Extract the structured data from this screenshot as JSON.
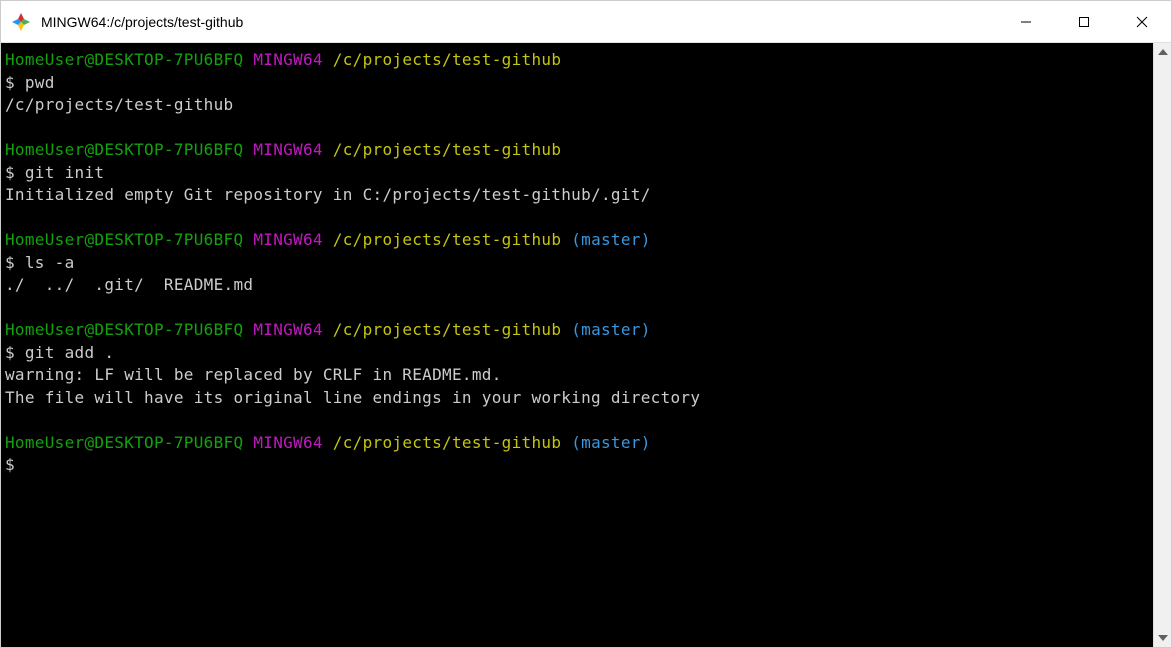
{
  "window": {
    "title": "MINGW64:/c/projects/test-github"
  },
  "terminal": {
    "blocks": [
      {
        "userHost": "HomeUser@DESKTOP-7PU6BFQ",
        "env": "MINGW64",
        "path": "/c/projects/test-github",
        "branch": "",
        "dollar": "$",
        "command": "pwd",
        "output": [
          "/c/projects/test-github"
        ]
      },
      {
        "userHost": "HomeUser@DESKTOP-7PU6BFQ",
        "env": "MINGW64",
        "path": "/c/projects/test-github",
        "branch": "",
        "dollar": "$",
        "command": "git init",
        "output": [
          "Initialized empty Git repository in C:/projects/test-github/.git/"
        ]
      },
      {
        "userHost": "HomeUser@DESKTOP-7PU6BFQ",
        "env": "MINGW64",
        "path": "/c/projects/test-github",
        "branch": "(master)",
        "dollar": "$",
        "command": "ls -a",
        "output": [
          "./  ../  .git/  README.md"
        ]
      },
      {
        "userHost": "HomeUser@DESKTOP-7PU6BFQ",
        "env": "MINGW64",
        "path": "/c/projects/test-github",
        "branch": "(master)",
        "dollar": "$",
        "command": "git add .",
        "output": [
          "warning: LF will be replaced by CRLF in README.md.",
          "The file will have its original line endings in your working directory"
        ]
      },
      {
        "userHost": "HomeUser@DESKTOP-7PU6BFQ",
        "env": "MINGW64",
        "path": "/c/projects/test-github",
        "branch": "(master)",
        "dollar": "$",
        "command": "",
        "output": []
      }
    ]
  }
}
